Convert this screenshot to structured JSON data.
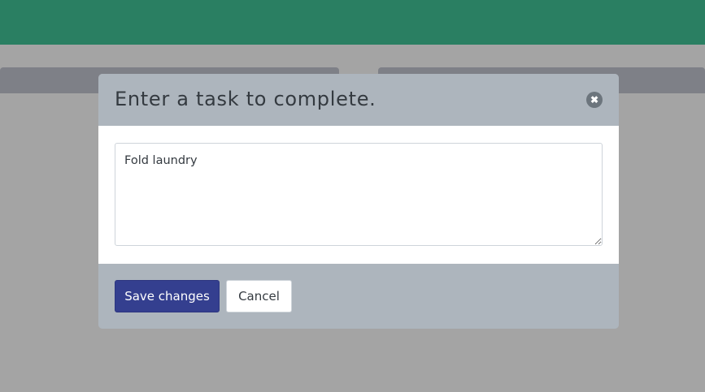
{
  "modal": {
    "title": "Enter a task to complete.",
    "close_symbol": "✖",
    "task_value": "Fold laundry",
    "save_label": "Save changes",
    "cancel_label": "Cancel"
  },
  "icons": {
    "close": "close-icon"
  },
  "colors": {
    "top_bar": "#2a7f62",
    "backdrop": "#a4a4a4",
    "modal_header": "#adb5bd",
    "primary_button": "#343f8f"
  }
}
